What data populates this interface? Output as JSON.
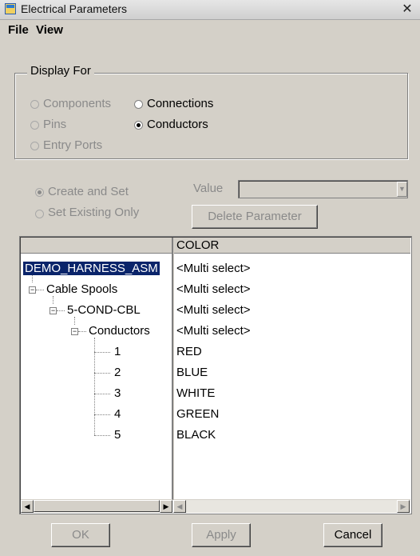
{
  "window": {
    "title": "Electrical Parameters",
    "close_glyph": "✕"
  },
  "menu": {
    "file": "File",
    "view": "View"
  },
  "display_for": {
    "legend": "Display For",
    "options": [
      {
        "label": "Components",
        "selected": false,
        "enabled": false
      },
      {
        "label": "Connections",
        "selected": false,
        "enabled": true
      },
      {
        "label": "Pins",
        "selected": false,
        "enabled": false
      },
      {
        "label": "Conductors",
        "selected": true,
        "enabled": true
      },
      {
        "label": "Entry Ports",
        "selected": false,
        "enabled": false
      }
    ]
  },
  "mode": {
    "create_and_set": "Create and Set",
    "set_existing_only": "Set Existing Only",
    "value_label": "Value",
    "delete_button": "Delete Parameter"
  },
  "grid": {
    "column_header": "COLOR",
    "rows": [
      {
        "node": "DEMO_HARNESS_ASM",
        "value": "<Multi select>"
      },
      {
        "node": "Cable Spools",
        "value": "<Multi select>"
      },
      {
        "node": "5-COND-CBL",
        "value": "<Multi select>"
      },
      {
        "node": "Conductors",
        "value": "<Multi select>"
      },
      {
        "node": "1",
        "value": "RED"
      },
      {
        "node": "2",
        "value": "BLUE"
      },
      {
        "node": "3",
        "value": "WHITE"
      },
      {
        "node": "4",
        "value": "GREEN"
      },
      {
        "node": "5",
        "value": "BLACK"
      }
    ]
  },
  "buttons": {
    "ok": "OK",
    "apply": "Apply",
    "cancel": "Cancel"
  },
  "icons": {
    "expander_minus": "⊟",
    "scroll_left": "◀",
    "scroll_right": "▶",
    "dropdown": "▼"
  }
}
